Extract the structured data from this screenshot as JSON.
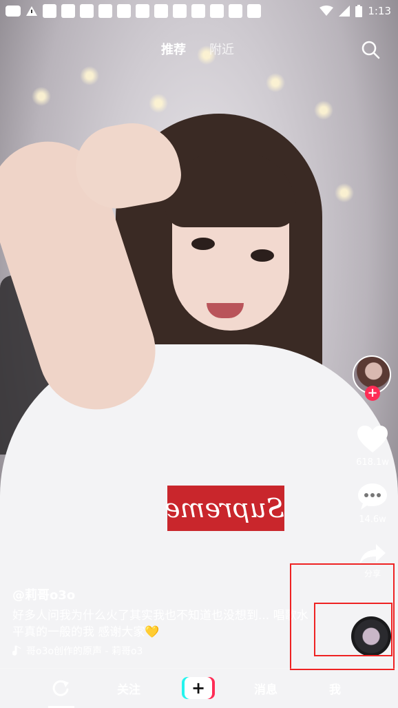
{
  "status_bar": {
    "time": "1:13"
  },
  "top_tabs": [
    {
      "label": "推荐",
      "active": true
    },
    {
      "label": "附近",
      "active": false
    }
  ],
  "icons": {
    "search": "search-icon",
    "heart": "heart-icon",
    "comment": "comment-icon",
    "share": "share-icon",
    "music": "music-note-icon",
    "home": "refresh-icon"
  },
  "actions": {
    "likes": "618.1w",
    "comments": "14.6w",
    "share_label": "分享"
  },
  "caption": {
    "author": "@莉哥o3o",
    "description": "好多人问我为什么火了其实我也不知道也没想到... 唱歌水平真的一般的我 感谢大家💛",
    "music": "哥o3o创作的原声 - 莉哥o3"
  },
  "shirt_logo": "Supreme",
  "bottom_nav": {
    "follow": "关注",
    "plus": "+",
    "messages": "消息",
    "me": "我"
  },
  "colors": {
    "accent": "#fe2c55",
    "accent2": "#25f4ee",
    "highlight": "#e22222"
  }
}
